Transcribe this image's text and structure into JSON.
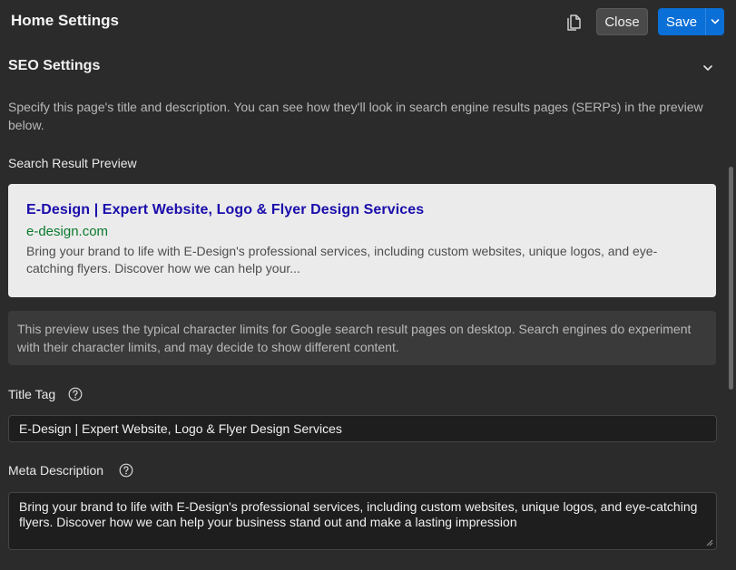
{
  "header": {
    "title": "Home Settings",
    "close_label": "Close",
    "save_label": "Save"
  },
  "section": {
    "title": "SEO Settings",
    "intro": "Specify this page's title and description. You can see how they'll look in search engine results pages (SERPs) in the preview below."
  },
  "preview": {
    "label": "Search Result Preview",
    "serp_title": "E-Design | Expert Website, Logo & Flyer Design Services",
    "serp_url": "e-design.com",
    "serp_description": "Bring your brand to life with E-Design's professional services, including custom websites, unique logos, and eye-catching flyers. Discover how we can help your...",
    "notice": "This preview uses the typical character limits for Google search result pages on desktop. Search engines do experiment with their character limits, and may decide to show different content."
  },
  "fields": {
    "title_tag_label": "Title Tag",
    "title_tag_value": "E-Design | Expert Website, Logo & Flyer Design Services",
    "meta_description_label": "Meta Description",
    "meta_description_value": "Bring your brand to life with E-Design's professional services, including custom websites, unique logos, and eye-catching flyers. Discover how we can help your business stand out and make a lasting impression"
  },
  "colors": {
    "background": "#2b2b2b",
    "accent": "#0a6fd6",
    "serp_link": "#1a0dab",
    "serp_url": "#0a7a2e"
  },
  "icons": [
    "copy-icon",
    "chevron-down-icon",
    "help-icon",
    "resize-handle-icon"
  ]
}
